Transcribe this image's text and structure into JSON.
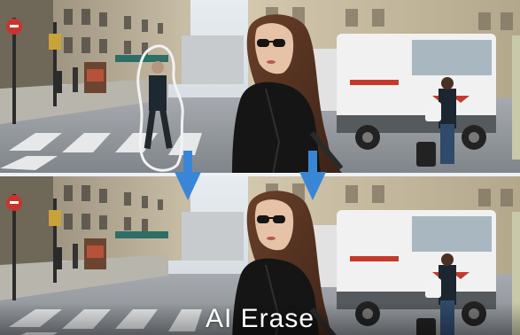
{
  "caption": {
    "text": "AI Erase"
  },
  "scene": {
    "top_panel": {
      "state": "before",
      "selection_outline": true
    },
    "bottom_panel": {
      "state": "after",
      "selection_outline": false
    },
    "arrows": 2
  },
  "colors": {
    "sky": "#d9e2ea",
    "building": "#b5a890",
    "street": "#8d9298",
    "crosswalk": "#e4e7ea",
    "truck_body": "#eeeeee",
    "truck_red": "#c43a2a",
    "jacket": "#141414",
    "hair": "#5a3422",
    "arrow": "#3a86d6",
    "outline": "#f2f2f2",
    "caption": "#ffffff"
  }
}
